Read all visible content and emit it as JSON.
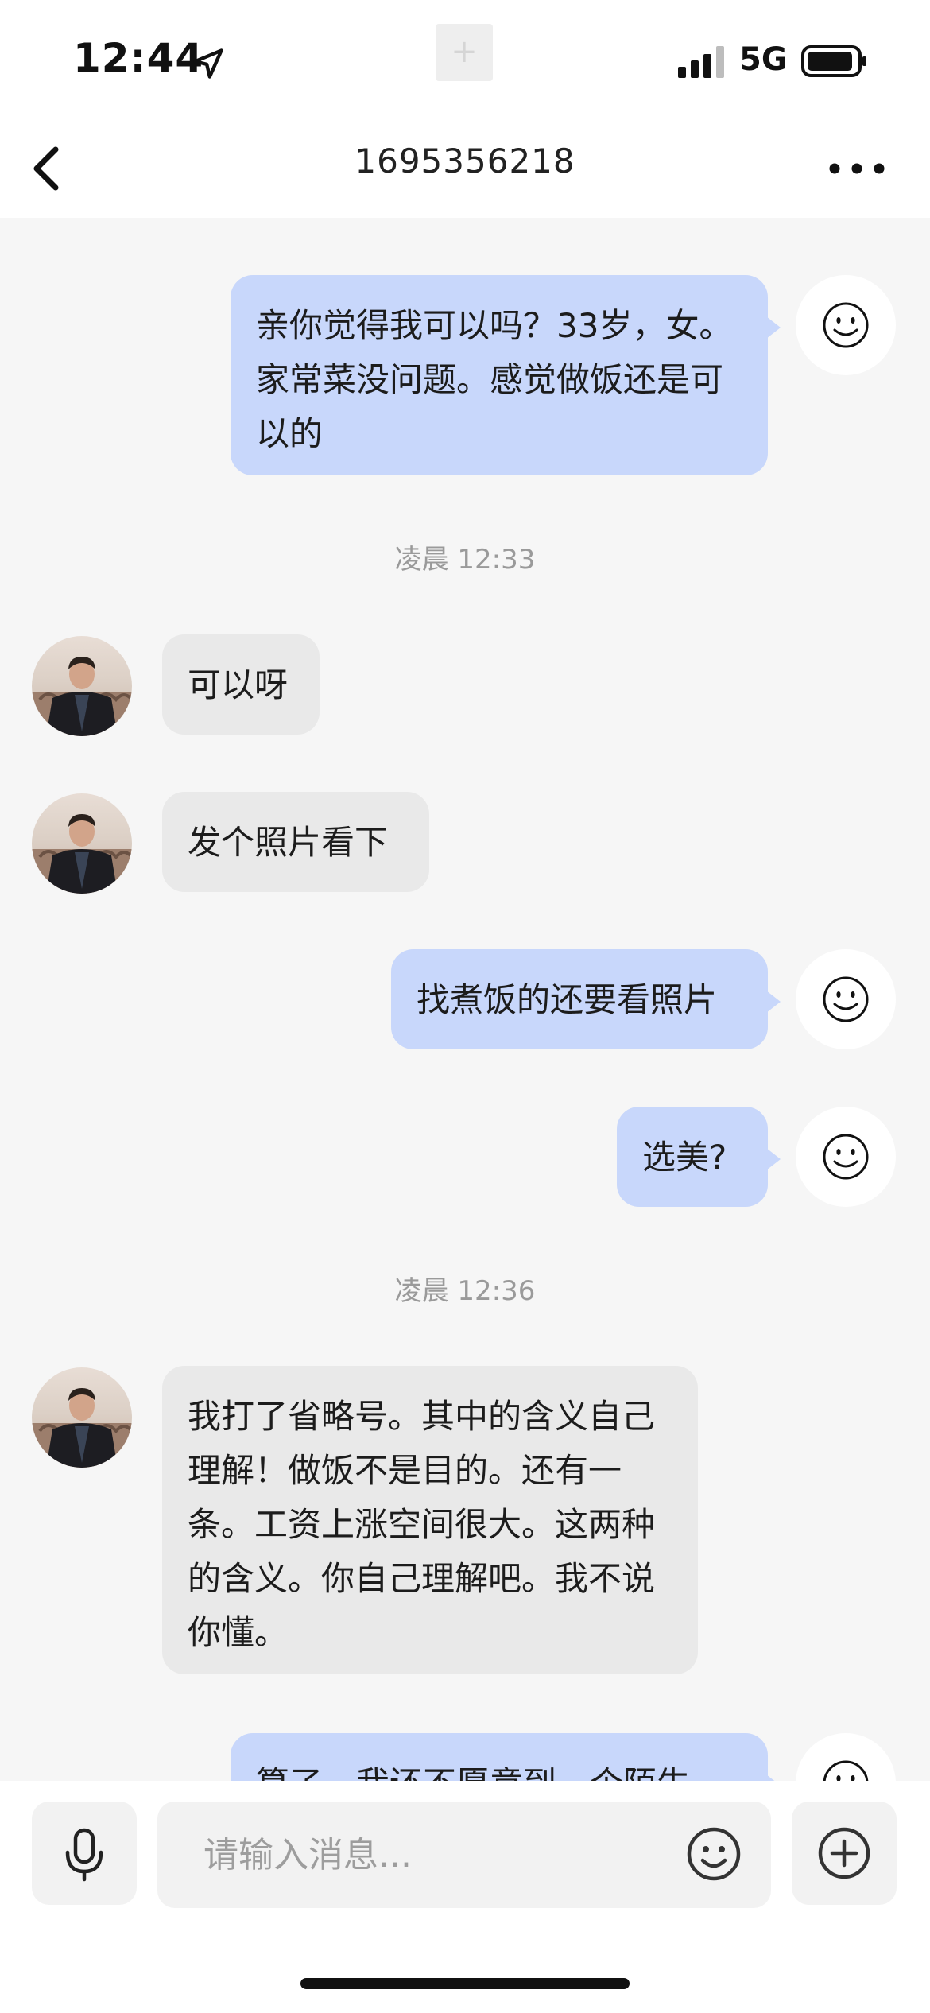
{
  "status_bar": {
    "time": "12:44",
    "network": "5G",
    "center_glyph": "+",
    "icons": [
      "location-arrow-icon",
      "signal-icon",
      "battery-icon"
    ]
  },
  "nav": {
    "title": "1695356218",
    "icons": [
      "back-chevron-icon",
      "more-dots-icon"
    ]
  },
  "messages": [
    {
      "sender": "me",
      "text": "亲你觉得我可以吗？33岁，女。家常菜没问题。感觉做饭还是可以的"
    },
    {
      "type": "timestamp",
      "text": "凌晨 12:33"
    },
    {
      "sender": "them",
      "text": "可以呀"
    },
    {
      "sender": "them",
      "text": "发个照片看下"
    },
    {
      "sender": "me",
      "text": "找煮饭的还要看照片"
    },
    {
      "sender": "me",
      "text": "选美?"
    },
    {
      "type": "timestamp",
      "text": "凌晨 12:36"
    },
    {
      "sender": "them",
      "text": "我打了省略号。其中的含义自己理解！做饭不是目的。还有一条。工资上涨空间很大。这两种的含义。你自己理解吧。我不说你懂。"
    },
    {
      "sender": "me",
      "text": "算了，我还不愿意到一个陌生"
    }
  ],
  "input": {
    "placeholder": "请输入消息...",
    "icons": [
      "microphone-icon",
      "emoji-icon",
      "plus-circle-icon"
    ]
  },
  "colors": {
    "my_bubble": "#c8d7fb",
    "their_bubble": "#e9e9e9",
    "background": "#f6f6f6"
  }
}
